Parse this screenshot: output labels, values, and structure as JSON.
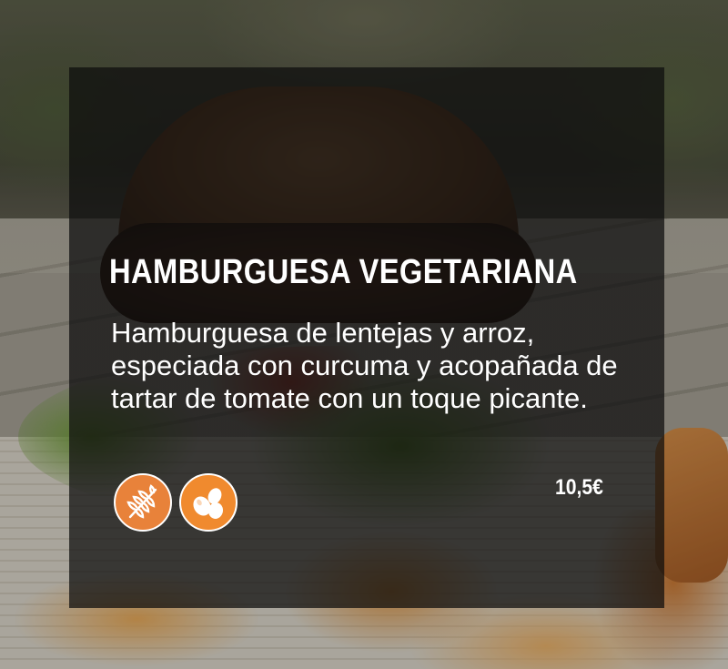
{
  "menu_item": {
    "name": "HAMBURGUESA VEGETARIANA",
    "description": "Hamburguesa de lentejas y arroz, especiada con curcuma y acopañada de tartar de tomate con un toque picante.",
    "price": "10,5€"
  },
  "allergens": [
    {
      "icon": "gluten-wheat-icon",
      "color": "#e8823a"
    },
    {
      "icon": "egg-icon",
      "color": "#f08a2e"
    }
  ],
  "colors": {
    "overlay": "#0c0c0c",
    "text": "#ffffff",
    "allergen_orange": "#ee8434"
  }
}
